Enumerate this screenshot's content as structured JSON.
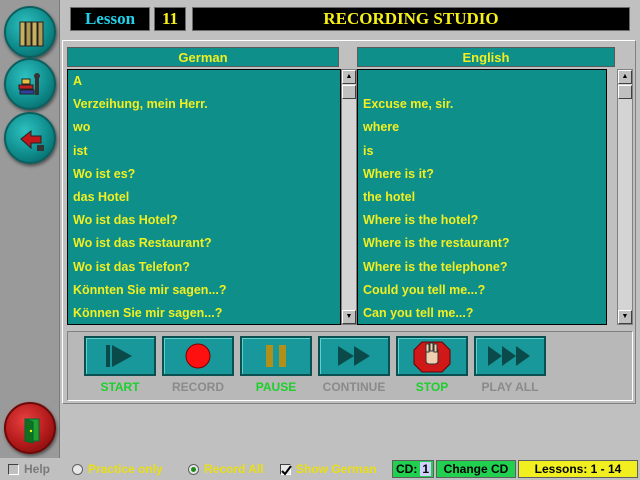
{
  "header": {
    "lesson_label": "Lesson",
    "lesson_number": "11",
    "title": "RECORDING STUDIO"
  },
  "rail": {
    "icons": [
      "books-icon",
      "study-tools-icon",
      "return-icon",
      "exit-door-icon"
    ]
  },
  "columns": {
    "german_header": "German",
    "english_header": "English"
  },
  "phrases": {
    "german": [
      "A",
      "Verzeihung, mein Herr.",
      "wo",
      "ist",
      "Wo ist es?",
      "das Hotel",
      "Wo ist das Hotel?",
      "Wo ist das Restaurant?",
      "Wo ist das Telefon?",
      "Könnten Sie mir sagen...?",
      "Können Sie mir sagen...?"
    ],
    "english": [
      "",
      "Excuse me, sir.",
      "where",
      "is",
      "Where is it?",
      "the hotel",
      "Where is the hotel?",
      "Where is the restaurant?",
      "Where is the telephone?",
      "Could you tell me...?",
      "Can you tell me...?"
    ]
  },
  "controls": {
    "start": "START",
    "record": "RECORD",
    "pause": "PAUSE",
    "continue": "CONTINUE",
    "stop": "STOP",
    "play_all": "PLAY ALL"
  },
  "status": {
    "help": "Help",
    "practice_only": "Practice only",
    "record_all": "Record All",
    "show_german": "Show German",
    "cd_label": "CD:",
    "cd_value": "1",
    "change_cd": "Change CD",
    "lessons": "Lessons:  1 - 14"
  },
  "colors": {
    "teal": "#0e8f8a",
    "yellow_text": "#f2ef20",
    "active_label": "#1cd02c",
    "inactive_label": "#8a8a8a"
  }
}
